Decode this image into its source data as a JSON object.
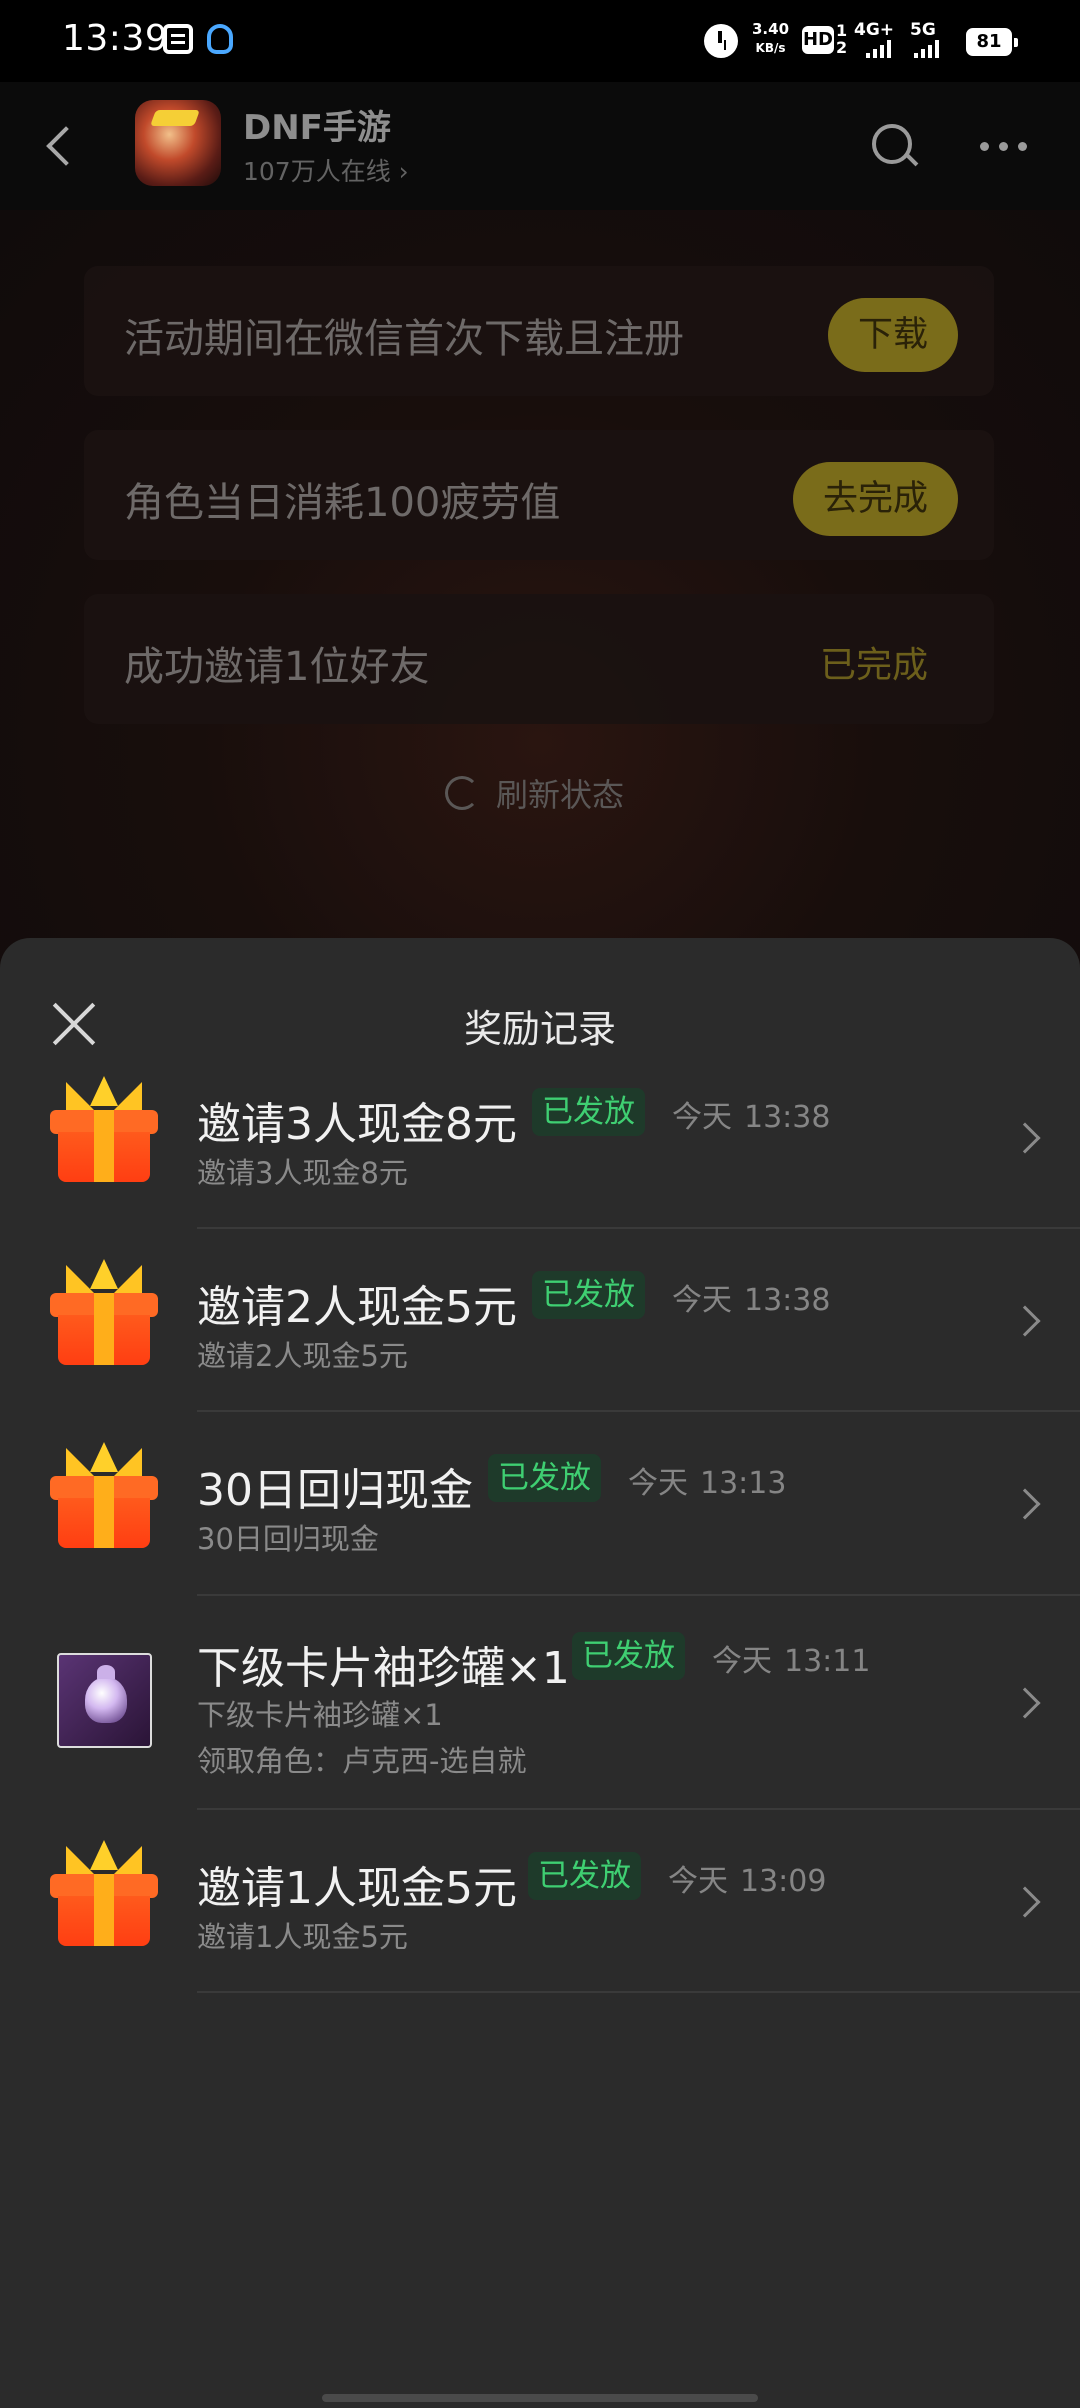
{
  "status_bar": {
    "time": "13:39",
    "speed_value": "3.40",
    "speed_unit": "KB/s",
    "hd_label": "HD",
    "hd_sub": "1\n2",
    "net1": "4G+",
    "net2": "5G",
    "battery": "81"
  },
  "header": {
    "game_name": "DNF手游",
    "online_count": "107万人在线 ›"
  },
  "background": {
    "tasks": [
      {
        "text": "活动期间在微信首次下载且注册",
        "action": "下载"
      },
      {
        "text": "角色当日消耗100疲劳值",
        "action": "去完成"
      },
      {
        "text": "成功邀请1位好友",
        "status": "已完成"
      }
    ],
    "refresh_label": "刷新状态"
  },
  "sheet": {
    "title": "奖励记录",
    "records": [
      {
        "icon": "gift-icon",
        "title": "邀请3人现金8元",
        "badge": "已发放",
        "day": "今天",
        "time": "13:38",
        "sub": "邀请3人现金8元"
      },
      {
        "icon": "gift-icon",
        "title": "邀请2人现金5元",
        "badge": "已发放",
        "day": "今天",
        "time": "13:38",
        "sub": "邀请2人现金5元"
      },
      {
        "icon": "gift-icon",
        "title": "30日回归现金",
        "badge": "已发放",
        "day": "今天",
        "time": "13:13",
        "sub": "30日回归现金"
      },
      {
        "icon": "card-jar-icon",
        "title": "下级卡片袖珍罐×1",
        "badge": "已发放",
        "day": "今天",
        "time": "13:11",
        "sub": "下级卡片袖珍罐×1",
        "sub2": "领取角色：卢克西-选自就"
      },
      {
        "icon": "gift-icon",
        "title": "邀请1人现金5元",
        "badge": "已发放",
        "day": "今天",
        "time": "13:09",
        "sub": "邀请1人现金5元"
      }
    ]
  },
  "colors": {
    "sheet_bg": "#2b2b2b",
    "badge_text": "#3fcf72",
    "badge_bg": "#1e3a2a",
    "task_button": "#7a6c1a"
  }
}
